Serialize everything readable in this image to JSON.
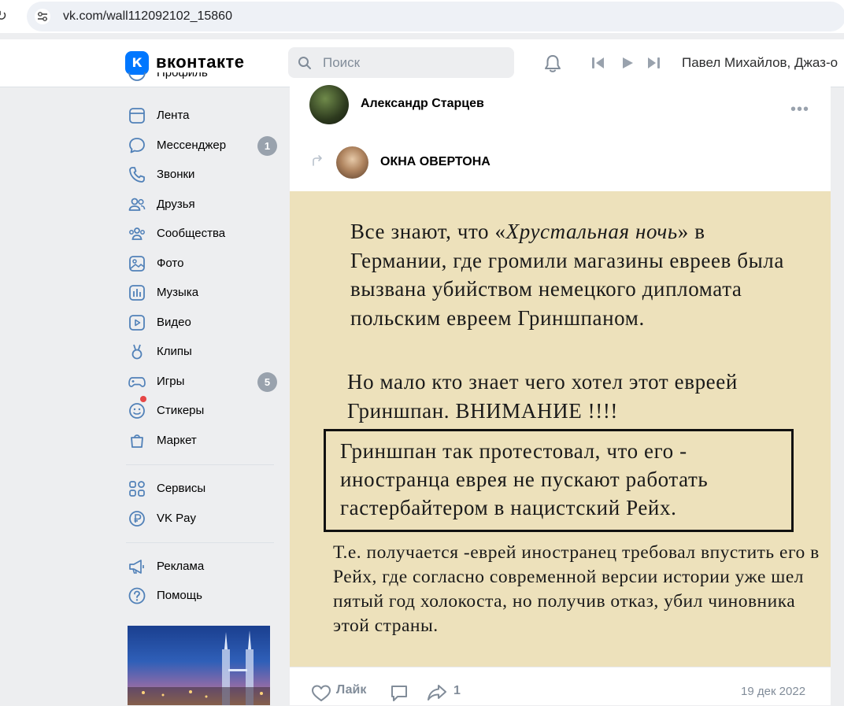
{
  "browser": {
    "url": "vk.com/wall112092102_15860"
  },
  "header": {
    "logo_letter": "К",
    "brand": "вконтакте",
    "search_placeholder": "Поиск",
    "player_track": "Павел Михайлов, Джаз-о"
  },
  "sidebar": {
    "partial_item": "Профиль",
    "items": [
      {
        "label": "Лента",
        "icon": "feed-icon"
      },
      {
        "label": "Мессенджер",
        "icon": "messenger-icon",
        "badge": "1"
      },
      {
        "label": "Звонки",
        "icon": "phone-icon"
      },
      {
        "label": "Друзья",
        "icon": "friends-icon"
      },
      {
        "label": "Сообщества",
        "icon": "communities-icon"
      },
      {
        "label": "Фото",
        "icon": "photo-icon"
      },
      {
        "label": "Музыка",
        "icon": "music-icon"
      },
      {
        "label": "Видео",
        "icon": "video-icon"
      },
      {
        "label": "Клипы",
        "icon": "clips-icon"
      },
      {
        "label": "Игры",
        "icon": "games-icon",
        "badge": "5"
      },
      {
        "label": "Стикеры",
        "icon": "stickers-icon"
      },
      {
        "label": "Маркет",
        "icon": "market-icon"
      },
      {
        "label": "Сервисы",
        "icon": "services-icon"
      },
      {
        "label": "VK Pay",
        "icon": "vkpay-icon"
      },
      {
        "label": "Реклама",
        "icon": "ads-icon"
      },
      {
        "label": "Помощь",
        "icon": "help-icon"
      }
    ]
  },
  "post": {
    "author": "Александр Старцев",
    "source": "ОКНА ОВЕРТОНА",
    "image_text": {
      "para1_before": "Все знают, что «",
      "para1_italic": "Хрустальная ночь",
      "para1_after": "» в Германии, где громили магазины евреев была вызвана убийством немецкого дипломата польским евреем Гриншпаном.",
      "para2": "Но мало кто знает чего хотел этот евреей Гриншпан. ВНИМАНИЕ !!!!",
      "box": "Гриншпан так протестовал, что его - иностранца еврея не пускают работать гастербайтером в нацистский Рейх.",
      "para3": "Т.е. получается -еврей иностранец требовал впустить его в Рейх, где согласно современной версии истории уже шел пятый год холокоста, но получив  отказ, убил чиновника этой страны."
    },
    "like_label": "Лайк",
    "share_count": "1",
    "date": "19 дек 2022"
  },
  "colors": {
    "accent": "#0077ff",
    "image_background": "#ede1bb",
    "badge": "#99a2ad",
    "muted_text": "#818c99"
  }
}
